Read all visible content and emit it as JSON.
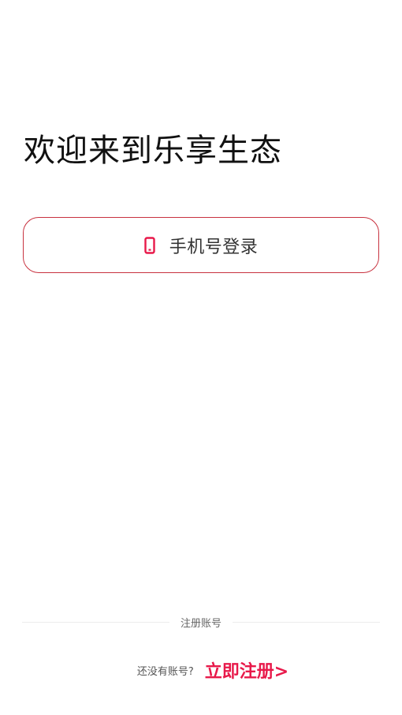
{
  "welcome": {
    "title": "欢迎来到乐享生态"
  },
  "login": {
    "phone_button_label": "手机号登录",
    "phone_icon": "mobile-phone-icon"
  },
  "register": {
    "divider_label": "注册账号",
    "no_account_text": "还没有账号?",
    "register_link_label": "立即注册>"
  },
  "colors": {
    "accent": "#e8194a",
    "button_border": "#c8323f",
    "title_text": "#111111",
    "muted_text": "#666666"
  }
}
